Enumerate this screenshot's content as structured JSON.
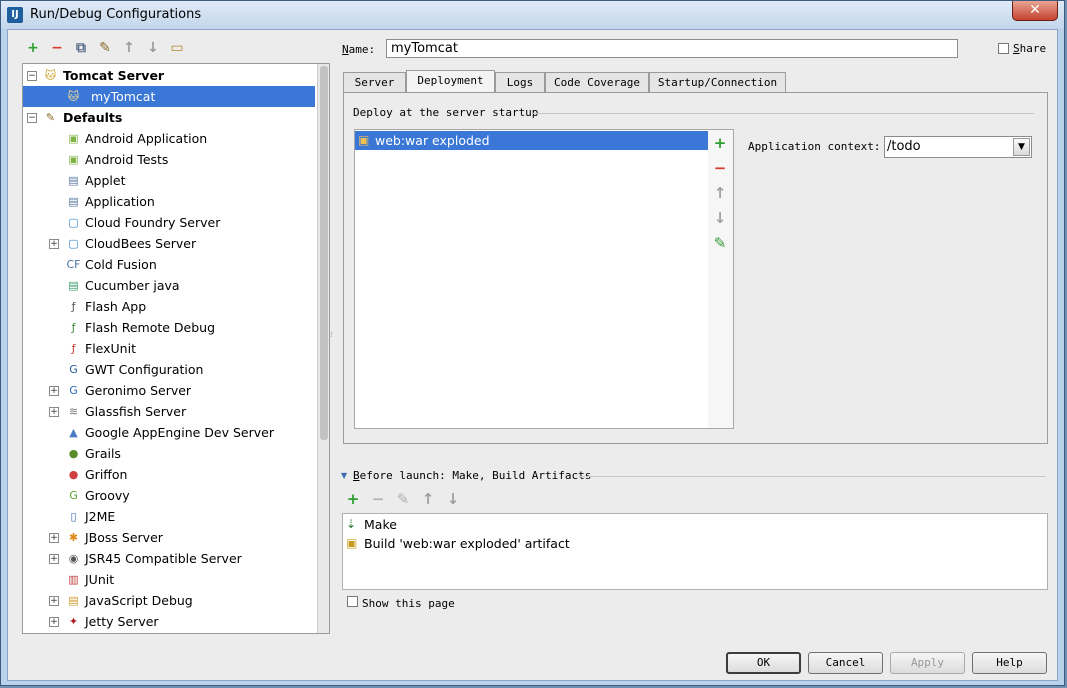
{
  "window": {
    "title": "Run/Debug Configurations",
    "app_icon_text": "IJ",
    "close_glyph": "✕"
  },
  "left_toolbar": [
    {
      "name": "add-config-button",
      "glyph": "+",
      "color": "#2e9e2e"
    },
    {
      "name": "remove-config-button",
      "glyph": "−",
      "color": "#d93a2b"
    },
    {
      "name": "copy-config-button",
      "glyph": "⧉",
      "color": "#5a6e8a"
    },
    {
      "name": "edit-defaults-button",
      "glyph": "✎",
      "color": "#8a6a2a"
    },
    {
      "name": "move-up-button",
      "glyph": "↑",
      "color": "#9a9a9a"
    },
    {
      "name": "move-down-button",
      "glyph": "↓",
      "color": "#9a9a9a"
    },
    {
      "name": "folder-button",
      "glyph": "▭",
      "color": "#b58a2a"
    }
  ],
  "tree": {
    "items": [
      {
        "label": "Tomcat Server",
        "level": 0,
        "expander": "−",
        "bold": true,
        "icon": "🐱",
        "icon_color": "#c89b1e"
      },
      {
        "label": "myTomcat",
        "level": 1,
        "selected": true,
        "icon": "🐱",
        "icon_color": "#c89b1e"
      },
      {
        "label": "Defaults",
        "level": 0,
        "expander": "−",
        "bold": true,
        "icon": "✎",
        "icon_color": "#8a6a2a"
      },
      {
        "label": "Android Application",
        "level": 1,
        "icon": "▣",
        "icon_color": "#7cb342"
      },
      {
        "label": "Android Tests",
        "level": 1,
        "icon": "▣",
        "icon_color": "#7cb342"
      },
      {
        "label": "Applet",
        "level": 1,
        "icon": "▤",
        "icon_color": "#5a7aa0"
      },
      {
        "label": "Application",
        "level": 1,
        "icon": "▤",
        "icon_color": "#5a7aa0"
      },
      {
        "label": "Cloud Foundry Server",
        "level": 1,
        "icon": "▢",
        "icon_color": "#3a8ad0"
      },
      {
        "label": "CloudBees Server",
        "level": 1,
        "expander": "+",
        "icon": "▢",
        "icon_color": "#3a8ad0"
      },
      {
        "label": "Cold Fusion",
        "level": 1,
        "icon": "CF",
        "icon_color": "#4a6fa5"
      },
      {
        "label": "Cucumber java",
        "level": 1,
        "icon": "▤",
        "icon_color": "#3a9a6a"
      },
      {
        "label": "Flash App",
        "level": 1,
        "icon": "ƒ",
        "icon_color": "#555"
      },
      {
        "label": "Flash Remote Debug",
        "level": 1,
        "icon": "ƒ",
        "icon_color": "#3a8a3a"
      },
      {
        "label": "FlexUnit",
        "level": 1,
        "icon": "ƒ",
        "icon_color": "#c0392b"
      },
      {
        "label": "GWT Configuration",
        "level": 1,
        "icon": "G",
        "icon_color": "#2a5a9a"
      },
      {
        "label": "Geronimo Server",
        "level": 1,
        "expander": "+",
        "icon": "G",
        "icon_color": "#2a6aba"
      },
      {
        "label": "Glassfish Server",
        "level": 1,
        "expander": "+",
        "icon": "≋",
        "icon_color": "#777"
      },
      {
        "label": "Google AppEngine Dev Server",
        "level": 1,
        "icon": "▲",
        "icon_color": "#4a7ac0"
      },
      {
        "label": "Grails",
        "level": 1,
        "icon": "●",
        "icon_color": "#5a8a2a"
      },
      {
        "label": "Griffon",
        "level": 1,
        "icon": "●",
        "icon_color": "#d04040"
      },
      {
        "label": "Groovy",
        "level": 1,
        "icon": "G",
        "icon_color": "#5aa02a"
      },
      {
        "label": "J2ME",
        "level": 1,
        "icon": "▯",
        "icon_color": "#3a6ab0"
      },
      {
        "label": "JBoss Server",
        "level": 1,
        "expander": "+",
        "icon": "✱",
        "icon_color": "#e08a1a"
      },
      {
        "label": "JSR45 Compatible Server",
        "level": 1,
        "expander": "+",
        "icon": "◉",
        "icon_color": "#555"
      },
      {
        "label": "JUnit",
        "level": 1,
        "icon": "▥",
        "icon_color": "#c04040"
      },
      {
        "label": "JavaScript Debug",
        "level": 1,
        "expander": "+",
        "icon": "▤",
        "icon_color": "#d09a2a"
      },
      {
        "label": "Jetty Server",
        "level": 1,
        "expander": "+",
        "icon": "✦",
        "icon_color": "#b02020"
      }
    ]
  },
  "name_field": {
    "label_first": "N",
    "label_rest": "ame:",
    "value": "myTomcat"
  },
  "share": {
    "label_first": "S",
    "label_rest": "hare",
    "checked": false
  },
  "tabs": [
    {
      "label": "Server"
    },
    {
      "label": "Deployment",
      "active": true
    },
    {
      "label": "Logs"
    },
    {
      "label": "Code Coverage"
    },
    {
      "label": "Startup/Connection"
    }
  ],
  "deployment": {
    "section_title": "Deploy at the server startup",
    "artifacts": [
      {
        "label": "web:war exploded",
        "selected": true
      }
    ],
    "context_label": "Application context:",
    "context_value": "/todo"
  },
  "deploy_toolbar": [
    {
      "name": "add-artifact-icon",
      "glyph": "+",
      "color": "#2e9e2e"
    },
    {
      "name": "remove-artifact-icon",
      "glyph": "−",
      "color": "#d93a2b"
    },
    {
      "name": "artifact-up-icon",
      "glyph": "↑",
      "color": "#a0a0a0"
    },
    {
      "name": "artifact-down-icon",
      "glyph": "↓",
      "color": "#a0a0a0"
    },
    {
      "name": "edit-artifact-icon",
      "glyph": "✎",
      "color": "#3a9a3a"
    }
  ],
  "before_launch": {
    "title_first": "B",
    "title_rest": "efore launch: Make, Build Artifacts",
    "items": [
      {
        "label": "Make",
        "icon": "⇣",
        "icon_color": "#2e7a2e"
      },
      {
        "label": "Build 'web:war exploded' artifact",
        "icon": "▣",
        "icon_color": "#c89b1e"
      }
    ]
  },
  "launch_toolbar": [
    {
      "name": "launch-add-icon",
      "glyph": "+",
      "color": "#2e9e2e"
    },
    {
      "name": "launch-remove-icon",
      "glyph": "−",
      "color": "#b0b0b0"
    },
    {
      "name": "launch-edit-icon",
      "glyph": "✎",
      "color": "#b0b0b0"
    },
    {
      "name": "launch-up-icon",
      "glyph": "↑",
      "color": "#a0a0a0"
    },
    {
      "name": "launch-down-icon",
      "glyph": "↓",
      "color": "#a0a0a0"
    }
  ],
  "show_page": {
    "label": "Show this page",
    "checked": false
  },
  "buttons": {
    "ok": "OK",
    "cancel": "Cancel",
    "apply": "Apply",
    "help": "Help"
  }
}
